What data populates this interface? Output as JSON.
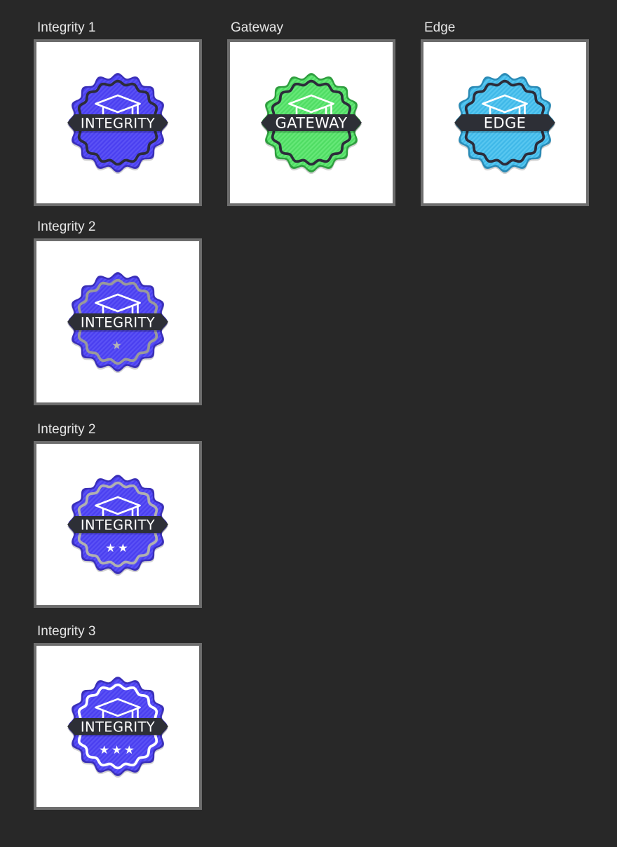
{
  "tiles": [
    {
      "label": "Integrity 1",
      "badge_text": "INTEGRITY",
      "stars": 0,
      "stars_text": "",
      "colors": {
        "fill": "#4a3ff0",
        "stripe": "#5b52f5",
        "edge": "#3a2fb8",
        "ring": "#2c2c3a"
      }
    },
    {
      "label": "Gateway",
      "badge_text": "GATEWAY",
      "stars": 0,
      "stars_text": "",
      "colors": {
        "fill": "#4fdc63",
        "stripe": "#66e878",
        "edge": "#2f9e3f",
        "ring": "#2c2c3a"
      }
    },
    {
      "label": "Edge",
      "badge_text": "EDGE",
      "stars": 0,
      "stars_text": "",
      "colors": {
        "fill": "#3fb8e8",
        "stripe": "#58c7f0",
        "edge": "#2a8ab5",
        "ring": "#2c2c3a"
      }
    },
    {
      "label": "Integrity 2",
      "badge_text": "INTEGRITY",
      "stars": 1,
      "stars_text": "★",
      "colors": {
        "fill": "#4a3ff0",
        "stripe": "#5b52f5",
        "edge": "#3a2fb8",
        "ring": "#9a9a9a"
      }
    },
    {
      "label": "Integrity 2",
      "badge_text": "INTEGRITY",
      "stars": 2,
      "stars_text": "★★",
      "colors": {
        "fill": "#4a3ff0",
        "stripe": "#5b52f5",
        "edge": "#3a2fb8",
        "ring": "#b0b0b0"
      }
    },
    {
      "label": "Integrity 3",
      "badge_text": "INTEGRITY",
      "stars": 3,
      "stars_text": "★★★",
      "colors": {
        "fill": "#4a3ff0",
        "stripe": "#5b52f5",
        "edge": "#3a2fb8",
        "ring": "#ffffff"
      }
    }
  ],
  "colors": {
    "background": "#282828",
    "frame": "#6d6d6d",
    "label": "#e6e6e6",
    "ribbon": "#2d2f36"
  },
  "icons": {
    "badge_emblem": "graduation-cap-icon",
    "rating": "star-icon"
  }
}
